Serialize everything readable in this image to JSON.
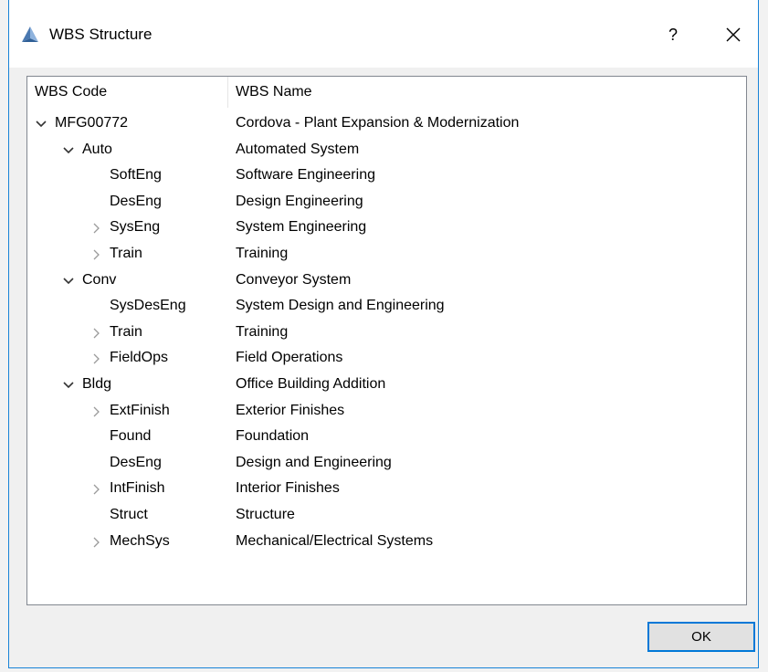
{
  "window": {
    "title": "WBS Structure",
    "help_label": "?",
    "close_icon": "close-icon",
    "app_icon": "app-triangle-icon",
    "accent_color": "#1883d7"
  },
  "tree": {
    "columns": {
      "code": "WBS Code",
      "name": "WBS Name"
    },
    "rows": [
      {
        "code": "MFG00772",
        "name": "Cordova - Plant Expansion & Modernization",
        "level": 0,
        "toggle": "expanded"
      },
      {
        "code": "Auto",
        "name": "Automated System",
        "level": 1,
        "toggle": "expanded"
      },
      {
        "code": "SoftEng",
        "name": "Software Engineering",
        "level": 2,
        "toggle": "none"
      },
      {
        "code": "DesEng",
        "name": "Design Engineering",
        "level": 2,
        "toggle": "none"
      },
      {
        "code": "SysEng",
        "name": "System Engineering",
        "level": 2,
        "toggle": "collapsed"
      },
      {
        "code": "Train",
        "name": "Training",
        "level": 2,
        "toggle": "collapsed"
      },
      {
        "code": "Conv",
        "name": "Conveyor System",
        "level": 1,
        "toggle": "expanded"
      },
      {
        "code": "SysDesEng",
        "name": "System Design and Engineering",
        "level": 2,
        "toggle": "none"
      },
      {
        "code": "Train",
        "name": "Training",
        "level": 2,
        "toggle": "collapsed"
      },
      {
        "code": "FieldOps",
        "name": "Field Operations",
        "level": 2,
        "toggle": "collapsed"
      },
      {
        "code": "Bldg",
        "name": "Office Building Addition",
        "level": 1,
        "toggle": "expanded"
      },
      {
        "code": "ExtFinish",
        "name": "Exterior Finishes",
        "level": 2,
        "toggle": "collapsed"
      },
      {
        "code": "Found",
        "name": "Foundation",
        "level": 2,
        "toggle": "none"
      },
      {
        "code": "DesEng",
        "name": "Design and Engineering",
        "level": 2,
        "toggle": "none"
      },
      {
        "code": "IntFinish",
        "name": "Interior Finishes",
        "level": 2,
        "toggle": "collapsed"
      },
      {
        "code": "Struct",
        "name": "Structure",
        "level": 2,
        "toggle": "none"
      },
      {
        "code": "MechSys",
        "name": "Mechanical/Electrical Systems",
        "level": 2,
        "toggle": "collapsed"
      }
    ]
  },
  "footer": {
    "ok_label": "OK"
  }
}
